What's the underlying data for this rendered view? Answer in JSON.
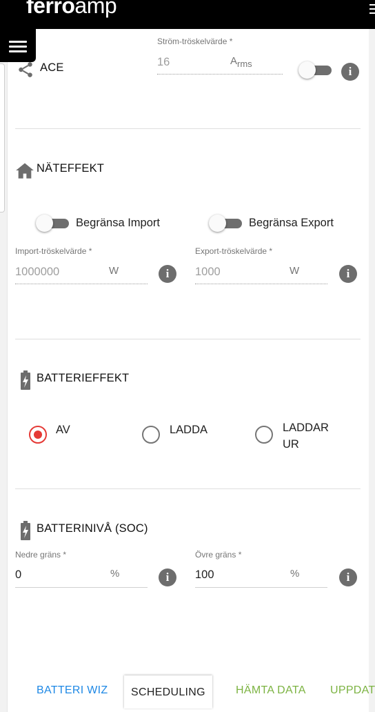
{
  "brand": {
    "logo_bold": "ferro",
    "logo_light": "amp"
  },
  "ace": {
    "label": "ACE",
    "threshold_label": "Ström-tröskelvärde",
    "threshold_value": "16",
    "unit_main": "A",
    "unit_sub": "rms",
    "toggle_on": false
  },
  "grid_power": {
    "title": "NÄTEFFEKT",
    "limit_import_label": "Begränsa Import",
    "limit_export_label": "Begränsa Export",
    "import_threshold_label": "Import-tröskelvärde",
    "import_threshold_value": "1000000",
    "export_threshold_label": "Export-tröskelvärde",
    "export_threshold_value": "1000",
    "unit": "W"
  },
  "battery_power": {
    "title": "BATTERIEFFEKT",
    "options": [
      {
        "label": "AV",
        "selected": true
      },
      {
        "label": "LADDA",
        "selected": false
      },
      {
        "label_line1": "LADDAR",
        "label_line2": "UR",
        "selected": false
      }
    ]
  },
  "battery_level": {
    "title": "BATTERINIVÅ (SOC)",
    "lower_label": "Nedre gräns",
    "lower_value": "0",
    "upper_label": "Övre gräns",
    "upper_value": "100",
    "unit": "%"
  },
  "required_mark": "*",
  "info_glyph": "i",
  "tabs": [
    "BATTERI WIZ",
    "SCHEDULING",
    "HÄMTA DATA",
    "UPPDAT"
  ],
  "colors": {
    "accent_red": "#e53935",
    "tab_blue": "#1e88e5",
    "tab_green": "#7cb342"
  }
}
